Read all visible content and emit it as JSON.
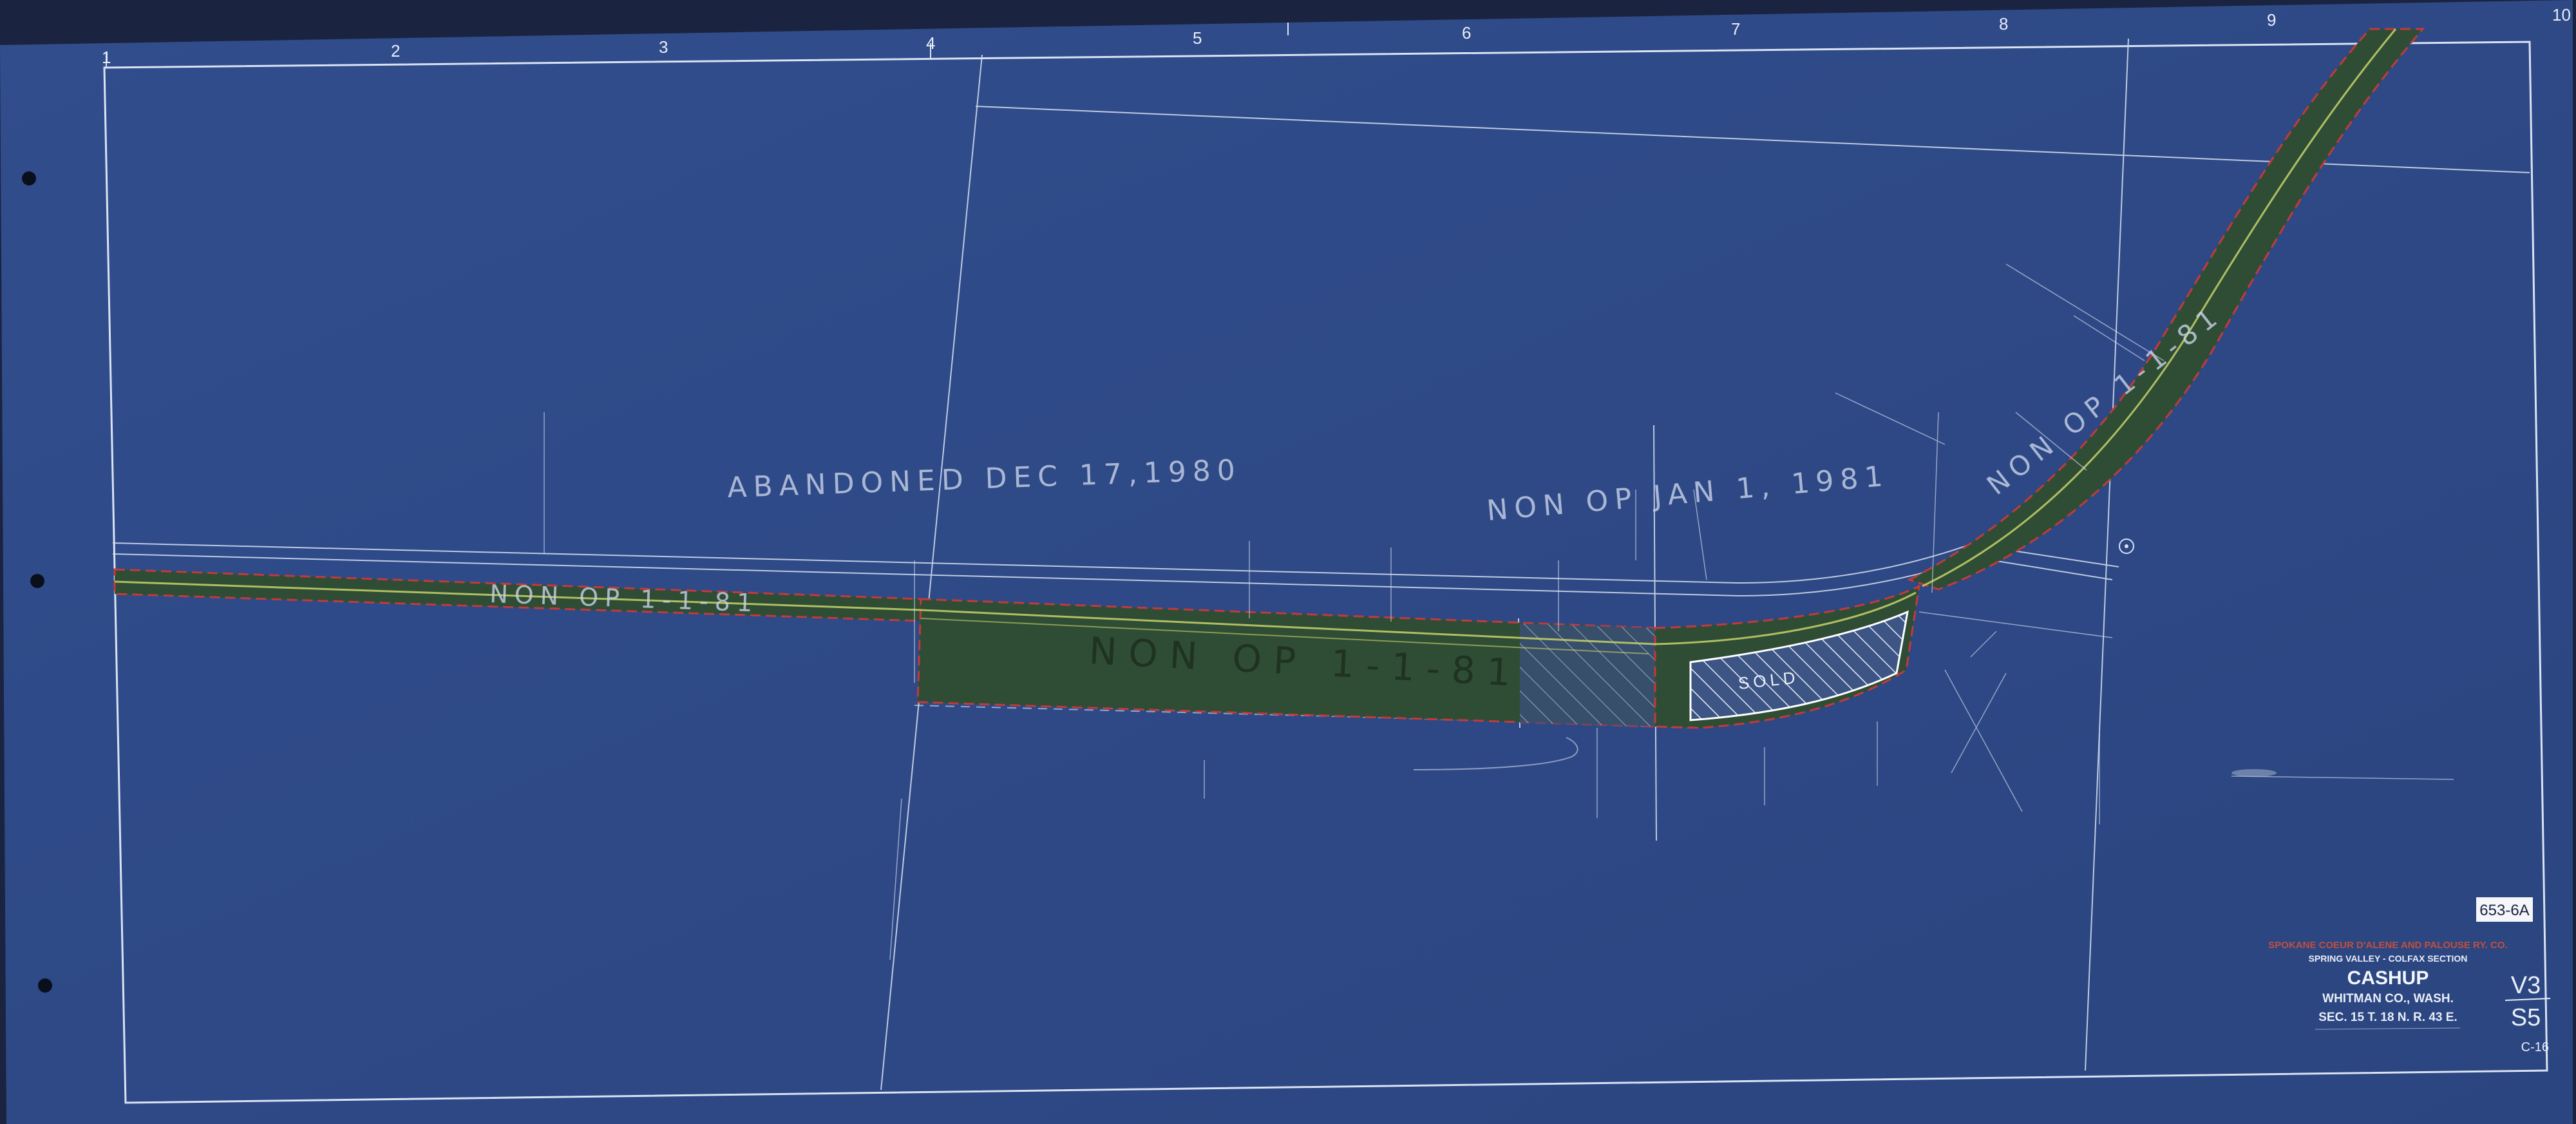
{
  "colors": {
    "paper": "#2f4a86",
    "line": "#d9e3f3",
    "track_fill": "#2f4d35",
    "track_center": "#c8d26a",
    "row_red": "#c23a3a",
    "title_red": "#c0503c"
  },
  "grid": {
    "columns": [
      "1",
      "2",
      "3",
      "4",
      "5",
      "6",
      "7",
      "8",
      "9",
      "10"
    ]
  },
  "annotations": {
    "abandoned": "ABANDONED  DEC 17,1980",
    "non_op_jan": "NON OP JAN 1, 1981",
    "non_op_left": "NON OP 1-1-81",
    "non_op_center": "NON OP  1-1-81",
    "non_op_right": "NON OP 1-1-81",
    "sold": "SOLD"
  },
  "title_block": {
    "drawing_number": "653-6A",
    "railway": "SPOKANE COEUR D'ALENE AND PALOUSE RY. CO.",
    "section": "SPRING VALLEY - COLFAX SECTION",
    "station": "CASHUP",
    "county": "WHITMAN CO., WASH.",
    "township": "SEC. 15 T. 18 N. R. 43 E.",
    "volume": "V3",
    "sheet_ref": "S5",
    "sheet_code": "C-16"
  },
  "page_icons": {
    "binder_holes": [
      "binder-hole-top",
      "binder-hole-middle",
      "binder-hole-bottom"
    ]
  }
}
